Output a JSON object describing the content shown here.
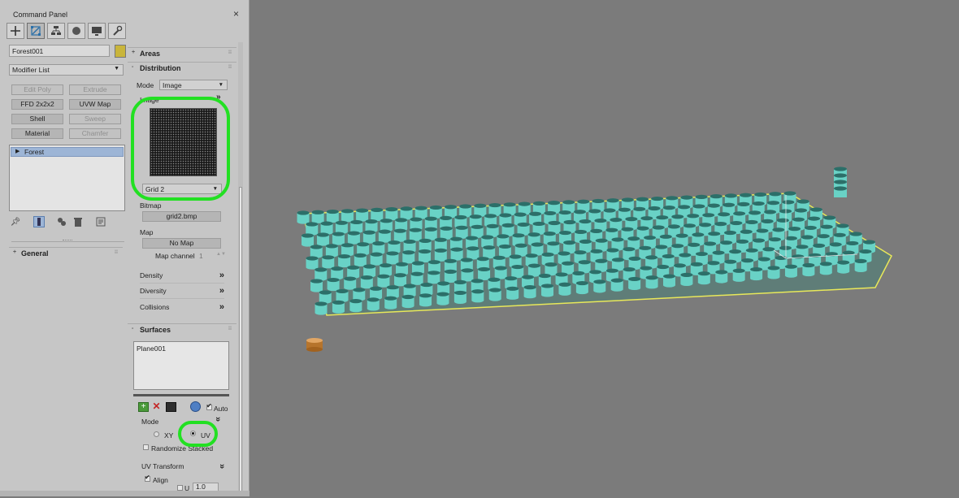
{
  "command_panel": {
    "title": "Command Panel",
    "close": "×",
    "tabs": [
      "create-icon",
      "modify-icon",
      "hierarchy-icon",
      "motion-icon",
      "display-icon",
      "utilities-icon"
    ],
    "object_name": "Forest001",
    "object_color": "#c9b53b",
    "modifier_list": "Modifier List",
    "modifier_buttons": [
      {
        "label": "Edit Poly",
        "enabled": false
      },
      {
        "label": "Extrude",
        "enabled": false
      },
      {
        "label": "FFD 2x2x2",
        "enabled": true
      },
      {
        "label": "UVW Map",
        "enabled": true
      },
      {
        "label": "Shell",
        "enabled": true
      },
      {
        "label": "Sweep",
        "enabled": false
      },
      {
        "label": "Material",
        "enabled": true
      },
      {
        "label": "Chamfer",
        "enabled": false
      }
    ],
    "stack": {
      "selected": "Forest"
    },
    "general_rollout": "General"
  },
  "rollouts": {
    "areas": {
      "title": "Areas",
      "sign": "+"
    },
    "distribution": {
      "title": "Distribution",
      "sign": "-",
      "mode_label": "Mode",
      "mode_value": "Image",
      "image_group": "Image",
      "image_preset": "Grid 2",
      "bitmap_label": "Bitmap",
      "bitmap_value": "grid2.bmp",
      "map_label": "Map",
      "map_value": "No Map",
      "map_channel_label": "Map channel",
      "map_channel_value": "1",
      "sections": [
        "Density",
        "Diversity",
        "Collisions"
      ]
    },
    "surfaces": {
      "title": "Surfaces",
      "sign": "-",
      "items": [
        "Plane001"
      ],
      "auto_label": "Auto",
      "auto_checked": true,
      "mode_label": "Mode",
      "xy_label": "XY",
      "uv_label": "UV",
      "selected_mode": "UV",
      "randomize_label": "Randomize Stacked",
      "uv_transform": "UV Transform",
      "align_label": "Align",
      "align_checked": true,
      "scale_u_label": "U",
      "scale_u_value": "1.0"
    }
  },
  "colors": {
    "panel_bg": "#c6c6c6",
    "viewport_bg": "#7b7b7b",
    "cylinder_fill": "#69d2c6",
    "cylinder_dark": "#2c6f69",
    "plane_edge": "#e8e85a",
    "highlight": "#22e022",
    "proxy_object": "#c98a3a"
  }
}
